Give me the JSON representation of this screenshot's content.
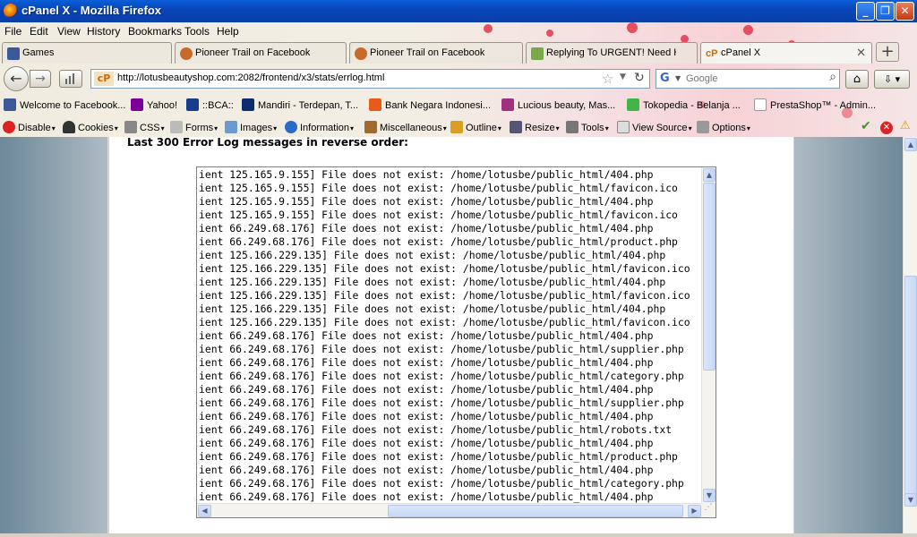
{
  "window": {
    "title": "cPanel X - Mozilla Firefox"
  },
  "menu": [
    "File",
    "Edit",
    "View",
    "History",
    "Bookmarks",
    "Tools",
    "Help"
  ],
  "tabs": [
    {
      "label": "Games",
      "icon": "facebook-icon"
    },
    {
      "label": "Pioneer Trail on Facebook",
      "icon": "pioneer-trail-icon"
    },
    {
      "label": "Pioneer Trail on Facebook",
      "icon": "pioneer-trail-icon"
    },
    {
      "label": "Replying To URGENT! Need HE...",
      "icon": "forum-icon"
    },
    {
      "label": "cPanel X",
      "icon": "cpanel-icon"
    }
  ],
  "nav": {
    "url": "http://lotusbeautyshop.com:2082/frontend/x3/stats/errlog.html",
    "search_placeholder": "Google",
    "search_engine": "G"
  },
  "bookmarks": [
    "Welcome to Facebook...",
    "Yahoo!",
    "::BCA::",
    "Mandiri - Terdepan, T...",
    "Bank Negara Indonesi...",
    "Lucious beauty, Mas...",
    "Tokopedia - Belanja ...",
    "PrestaShop™ - Admin..."
  ],
  "devbar": [
    "Disable",
    "Cookies",
    "CSS",
    "Forms",
    "Images",
    "Information",
    "Miscellaneous",
    "Outline",
    "Resize",
    "Tools",
    "View Source",
    "Options"
  ],
  "page": {
    "heading": "Last 300 Error Log messages in reverse order:",
    "log_lines": [
      "ient 125.165.9.155] File does not exist: /home/lotusbe/public_html/404.php",
      "ient 125.165.9.155] File does not exist: /home/lotusbe/public_html/favicon.ico",
      "ient 125.165.9.155] File does not exist: /home/lotusbe/public_html/404.php",
      "ient 125.165.9.155] File does not exist: /home/lotusbe/public_html/favicon.ico",
      "ient 66.249.68.176] File does not exist: /home/lotusbe/public_html/404.php",
      "ient 66.249.68.176] File does not exist: /home/lotusbe/public_html/product.php",
      "ient 125.166.229.135] File does not exist: /home/lotusbe/public_html/404.php",
      "ient 125.166.229.135] File does not exist: /home/lotusbe/public_html/favicon.ico",
      "ient 125.166.229.135] File does not exist: /home/lotusbe/public_html/404.php",
      "ient 125.166.229.135] File does not exist: /home/lotusbe/public_html/favicon.ico",
      "ient 125.166.229.135] File does not exist: /home/lotusbe/public_html/404.php",
      "ient 125.166.229.135] File does not exist: /home/lotusbe/public_html/favicon.ico",
      "ient 66.249.68.176] File does not exist: /home/lotusbe/public_html/404.php",
      "ient 66.249.68.176] File does not exist: /home/lotusbe/public_html/supplier.php",
      "ient 66.249.68.176] File does not exist: /home/lotusbe/public_html/404.php",
      "ient 66.249.68.176] File does not exist: /home/lotusbe/public_html/category.php",
      "ient 66.249.68.176] File does not exist: /home/lotusbe/public_html/404.php",
      "ient 66.249.68.176] File does not exist: /home/lotusbe/public_html/supplier.php",
      "ient 66.249.68.176] File does not exist: /home/lotusbe/public_html/404.php",
      "ient 66.249.68.176] File does not exist: /home/lotusbe/public_html/robots.txt",
      "ient 66.249.68.176] File does not exist: /home/lotusbe/public_html/404.php",
      "ient 66.249.68.176] File does not exist: /home/lotusbe/public_html/product.php",
      "ient 66.249.68.176] File does not exist: /home/lotusbe/public_html/404.php",
      "ient 66.249.68.176] File does not exist: /home/lotusbe/public_html/category.php",
      "ient 66.249.68.176] File does not exist: /home/lotusbe/public_html/404.php"
    ]
  },
  "colors": {
    "titlebar": "#0845b8",
    "page_bg": "#6d8898"
  }
}
